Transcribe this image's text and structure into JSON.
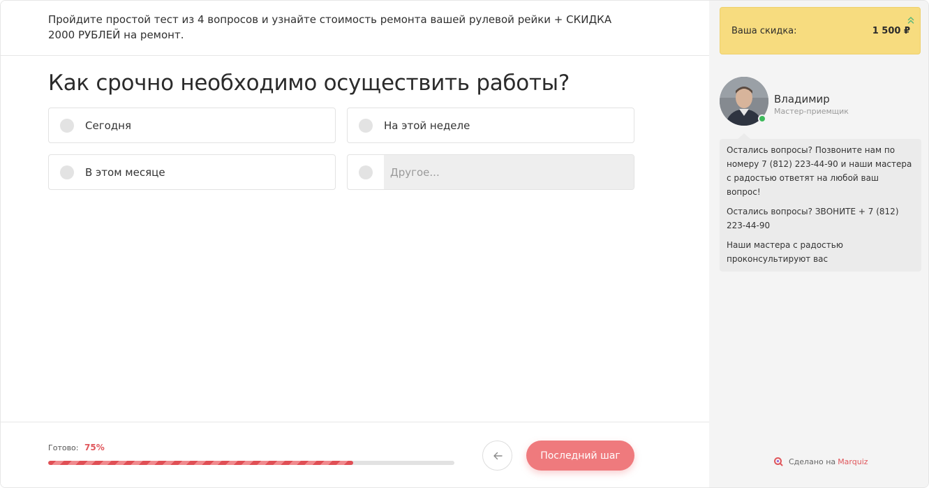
{
  "header": {
    "intro": "Пройдите простой тест из 4 вопросов и узнайте стоимость ремонта вашей рулевой рейки + СКИДКА 2000 РУБЛЕЙ на ремонт."
  },
  "question": {
    "title": "Как срочно необходимо осуществить работы?",
    "options": [
      {
        "label": "Сегодня"
      },
      {
        "label": "На этой неделе"
      },
      {
        "label": "В этом месяце"
      },
      {
        "label": "",
        "placeholder": "Другое..."
      }
    ]
  },
  "footer": {
    "progress_label": "Готово:",
    "progress_text": "75%",
    "progress_fraction": 0.75,
    "next_button": "Последний шаг",
    "back_icon": "arrow-left-icon"
  },
  "sidebar": {
    "discount_label": "Ваша скидка:",
    "discount_value": "1 500 ₽",
    "discount_icon": "double-chevron-up-icon",
    "manager_name": "Владимир",
    "manager_role": "Мастер-приемщик",
    "messages": [
      "Остались вопросы? Позвоните нам по номеру 7 (812) 223-44-90 и наши мастера с радостью ответят на любой ваш вопрос!",
      "Остались вопросы? ЗВОНИТЕ + 7 (812) 223-44-90",
      "Наши мастера с радостью проконсультируют вас"
    ],
    "made_by_text": "Сделано на",
    "made_by_brand": "Marquiz"
  },
  "colors": {
    "accent": "#e0565b",
    "button": "#ef7a7d",
    "discount_bg": "#f7dc7f",
    "online": "#3cb95a"
  }
}
